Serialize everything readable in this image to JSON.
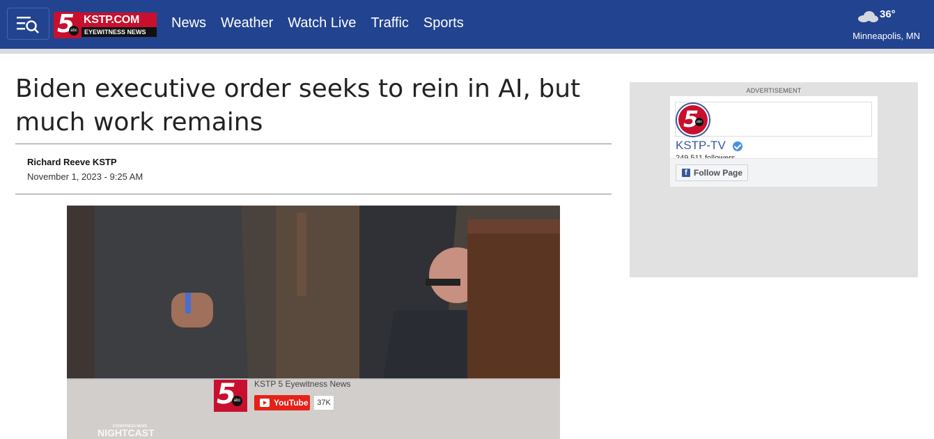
{
  "header": {
    "logo": {
      "top": "KSTP.COM",
      "bottom": "EYEWITNESS NEWS",
      "numeral": "5",
      "network": "abc"
    },
    "nav": [
      "News",
      "Weather",
      "Watch Live",
      "Traffic",
      "Sports"
    ],
    "weather": {
      "temp": "36°",
      "location": "Minneapolis, MN",
      "icon": "cloud-icon"
    }
  },
  "article": {
    "headline": "Biden executive order seeks to rein in AI, but much work remains",
    "byline": "Richard Reeve KSTP",
    "date": "November 1, 2023 - 9:25 AM"
  },
  "video": {
    "channel": "KSTP 5 Eyewitness News",
    "youtube_label": "YouTube",
    "subscriber_count": "37K",
    "watermark": "NIGHTCAST",
    "watermark_top": "EYEWITNESS NEWS"
  },
  "sidebar_ad": {
    "label": "ADVERTISEMENT",
    "page_name": "KSTP-TV",
    "followers": "249,511 followers",
    "follow_button": "Follow Page"
  },
  "colors": {
    "header_bg": "#22438f",
    "brand_red": "#c8102e",
    "youtube_red": "#e62117",
    "facebook_blue": "#3b5998"
  }
}
